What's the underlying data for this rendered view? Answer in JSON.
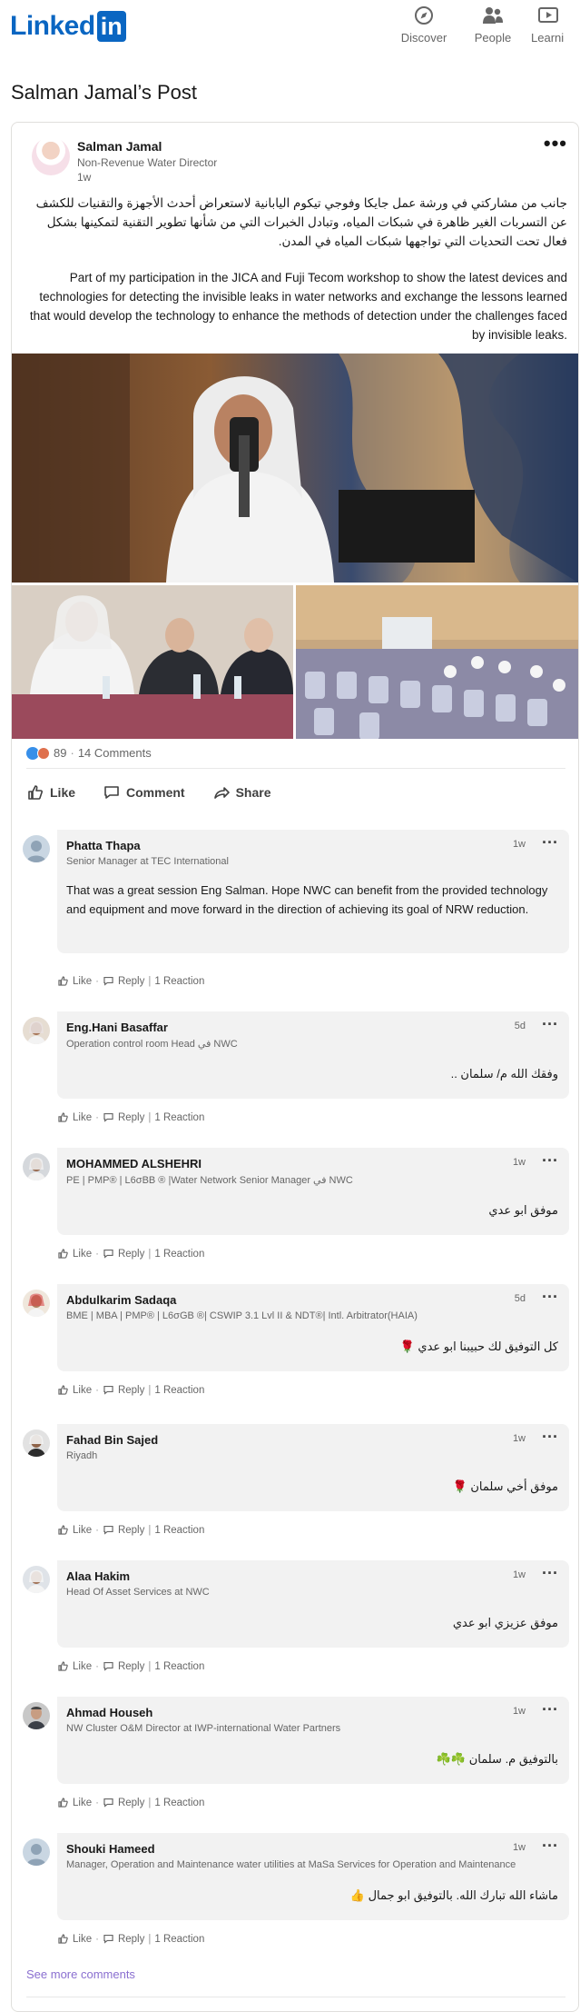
{
  "nav": {
    "logo_text": "Linked",
    "logo_in": "in",
    "items": [
      {
        "label": "Discover",
        "icon": "compass-icon"
      },
      {
        "label": "People",
        "icon": "people-icon"
      },
      {
        "label": "Learni",
        "icon": "learning-play-icon"
      }
    ]
  },
  "page_title": "Salman Jamal’s Post",
  "post": {
    "author": "Salman Jamal",
    "headline": "Non-Revenue Water Director",
    "time": "1w",
    "text_ar": "جانب من مشاركتي في ورشة عمل جايكا وفوجي تيكوم اليابانية لاستعراض أحدث الأجهزة والتقنيات للكشف عن التسربات الغير ظاهرة في شبكات المياه، وتبادل الخبرات التي من شأنها تطوير التقنية لتمكينها بشكل فعال تحت التحديات التي تواجهها شبكات المياه في المدن.",
    "text_en": "Part of my participation in the JICA and Fuji Tecom workshop to show the latest devices and technologies for detecting the invisible leaks in water networks and exchange the lessons learned that would develop the technology to enhance the methods of detection under the challenges faced by invisible leaks.",
    "reaction_count": "89",
    "comment_count": "14 Comments",
    "actions": {
      "like": "Like",
      "comment": "Comment",
      "share": "Share"
    }
  },
  "comment_actions": {
    "like": "Like",
    "reply": "Reply",
    "reactions": "1 Reaction"
  },
  "comments": [
    {
      "name": "Phatta Thapa",
      "headline": "Senior Manager at TEC International",
      "time": "1w",
      "text": "That was a great session Eng Salman. Hope NWC can benefit from the provided technology and equipment and move forward in the direction of achieving its goal of NRW reduction.",
      "rtl": false
    },
    {
      "name": "Eng.Hani Basaffar",
      "headline": "Operation control room Head في NWC",
      "time": "5d",
      "text": "وفقك الله م/ سلمان ..",
      "rtl": true
    },
    {
      "name": "MOHAMMED ALSHEHRI",
      "headline": "PE | PMP® | L6σBB ® |Water Network Senior Manager في NWC",
      "time": "1w",
      "text": "موفق ابو عدي",
      "rtl": true
    },
    {
      "name": "Abdulkarim Sadaqa",
      "headline": "BME | MBA | PMP® | L6σGB ®| CSWIP 3.1 Lvl II & NDT®| Intl. Arbitrator(HAIA)",
      "time": "5d",
      "text": "كل التوفيق لك حبيبنا ابو عدي 🌹",
      "rtl": true
    },
    {
      "name": "Fahad Bin Sajed",
      "headline": "Riyadh",
      "time": "1w",
      "text": "موفق أخي سلمان 🌹",
      "rtl": true
    },
    {
      "name": "Alaa Hakim",
      "headline": "Head Of Asset Services at NWC",
      "time": "1w",
      "text": "موفق عزيزي ابو عدي",
      "rtl": true
    },
    {
      "name": "Ahmad Househ",
      "headline": "NW Cluster O&M Director at IWP-international Water Partners",
      "time": "1w",
      "text": "بالتوفيق م. سلمان ☘️☘️",
      "rtl": true
    },
    {
      "name": "Shouki Hameed",
      "headline": "Manager, Operation and Maintenance water utilities at MaSa Services for Operation and Maintenance",
      "time": "1w",
      "text": "ماشاء الله تبارك الله. بالتوفيق ابو جمال 👍",
      "rtl": true
    }
  ],
  "see_more": "See more comments",
  "colors": {
    "brand": "#0a66c2",
    "link_purple": "#8a6fd0",
    "bubble": "#f2f2f2"
  }
}
